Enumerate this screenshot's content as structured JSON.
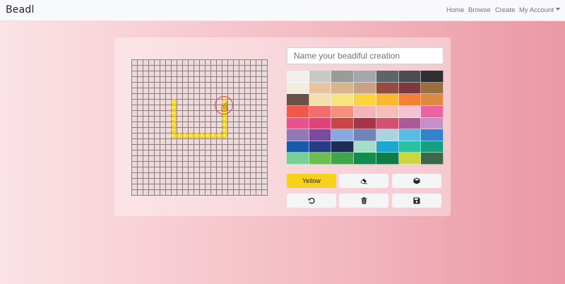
{
  "navbar": {
    "brand": "Beadl",
    "links": [
      {
        "label": "Home"
      },
      {
        "label": "Browse"
      },
      {
        "label": "Create"
      },
      {
        "label": "My Account"
      }
    ]
  },
  "editor": {
    "name_placeholder": "Name your beadiful creation",
    "grid_size": 24,
    "selected_color_label": "Yellow",
    "selected_color": "#f7d21b",
    "beads": [
      [
        7,
        7
      ],
      [
        7,
        8
      ],
      [
        7,
        9
      ],
      [
        7,
        10
      ],
      [
        7,
        11
      ],
      [
        7,
        12
      ],
      [
        7,
        13
      ],
      [
        8,
        13
      ],
      [
        9,
        13
      ],
      [
        10,
        13
      ],
      [
        11,
        13
      ],
      [
        12,
        13
      ],
      [
        13,
        13
      ],
      [
        14,
        13
      ],
      [
        15,
        13
      ],
      [
        16,
        13
      ],
      [
        16,
        12
      ],
      [
        16,
        11
      ],
      [
        16,
        10
      ],
      [
        16,
        9
      ],
      [
        16,
        8
      ],
      [
        16,
        7
      ]
    ],
    "palette": [
      "#f4eeef",
      "#c8c8c8",
      "#9b9b9b",
      "#a3a8a8",
      "#5f6466",
      "#4d4c52",
      "#303032",
      "#f5ece0",
      "#e9c39c",
      "#d9b48d",
      "#caa184",
      "#984a3e",
      "#7f3641",
      "#9a6f3c",
      "#6b5149",
      "#f4dfb3",
      "#f7e680",
      "#fcd53a",
      "#fbb82d",
      "#f58136",
      "#df8a42",
      "#f2574c",
      "#f56c6c",
      "#f4907b",
      "#f3b5b8",
      "#f5bfb8",
      "#f7c2d2",
      "#e964a1",
      "#e8528d",
      "#e0427e",
      "#cb4449",
      "#a6354a",
      "#d54f6f",
      "#ad5a98",
      "#c78fca",
      "#9179b8",
      "#7a4a9f",
      "#88a9dd",
      "#6f84b8",
      "#a7d5e0",
      "#5bbbe8",
      "#3482c7",
      "#1b5aa6",
      "#263d83",
      "#1e2d55",
      "#a6ddc6",
      "#1aa7d2",
      "#2cbfa1",
      "#159f7f",
      "#77d196",
      "#6cbf4c",
      "#43a54b",
      "#138c4f",
      "#0f7c45",
      "#ccd63f",
      "#3e6649"
    ]
  },
  "toolbar": {
    "eraser_icon": "eraser-icon",
    "box_icon": "cube-icon",
    "undo_icon": "undo-icon",
    "trash_icon": "trash-icon",
    "save_icon": "save-icon"
  }
}
